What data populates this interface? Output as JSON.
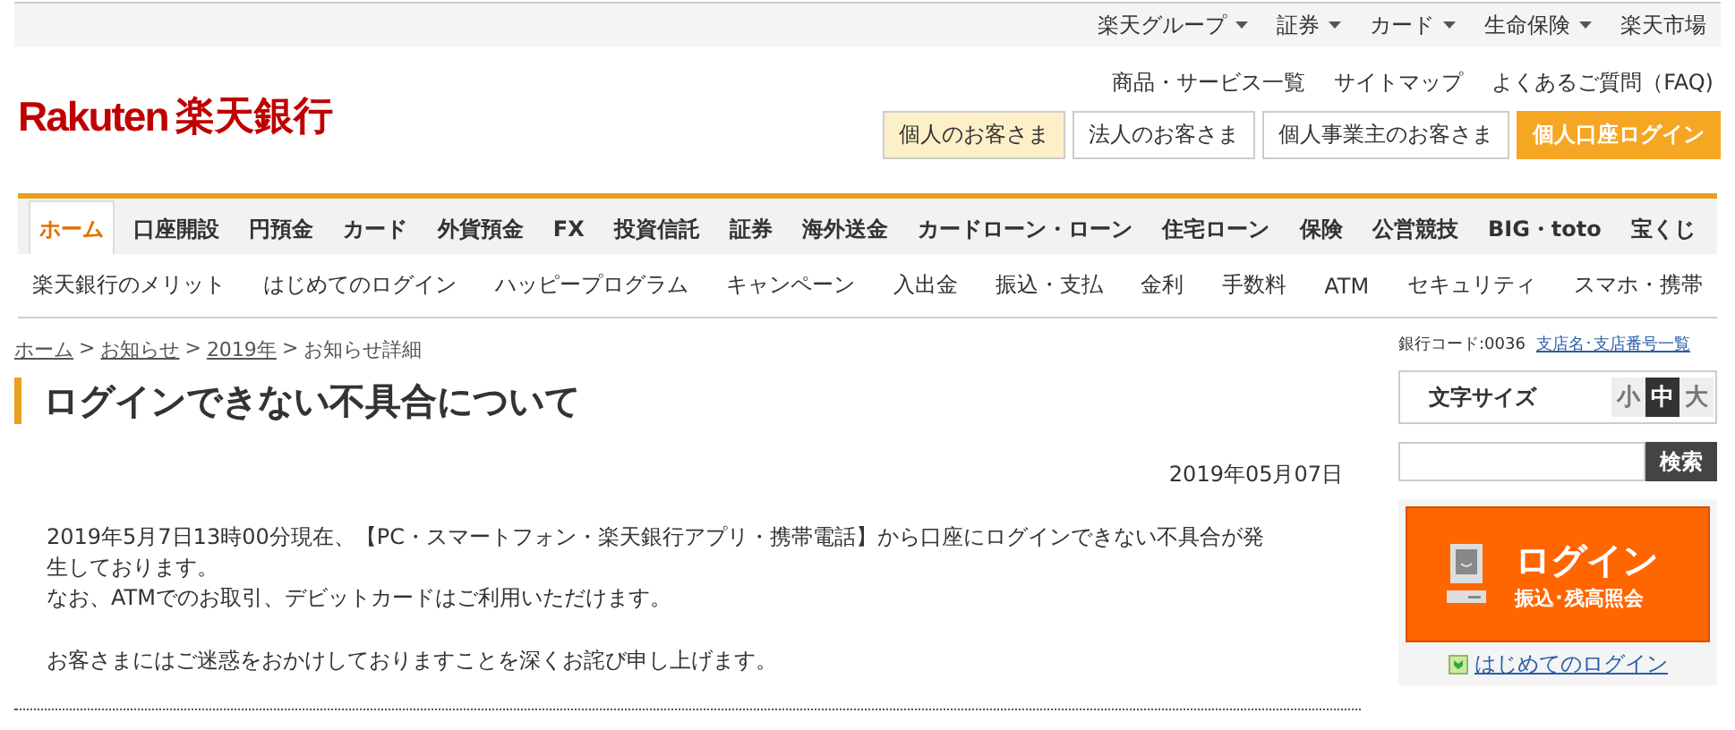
{
  "top_links": [
    {
      "label": "楽天グループ",
      "dropdown": true
    },
    {
      "label": "証券",
      "dropdown": true
    },
    {
      "label": "カード",
      "dropdown": true
    },
    {
      "label": "生命保険",
      "dropdown": true
    },
    {
      "label": "楽天市場",
      "dropdown": false
    }
  ],
  "logo": {
    "brand": "Rakuten",
    "name": "楽天銀行"
  },
  "utility_links": [
    "商品・サービス一覧",
    "サイトマップ",
    "よくあるご質問（FAQ)"
  ],
  "audience_buttons": [
    {
      "label": "個人のお客さま",
      "kind": "audience",
      "selected": true
    },
    {
      "label": "法人のお客さま",
      "kind": "audience",
      "selected": false
    },
    {
      "label": "個人事業主のお客さま",
      "kind": "audience",
      "selected": false
    },
    {
      "label": "個人口座ログイン",
      "kind": "primary"
    }
  ],
  "main_nav": [
    {
      "label": "ホーム",
      "selected": true
    },
    {
      "label": "口座開設",
      "selected": false
    },
    {
      "label": "円預金",
      "selected": false
    },
    {
      "label": "カード",
      "selected": false
    },
    {
      "label": "外貨預金",
      "selected": false
    },
    {
      "label": "FX",
      "selected": false
    },
    {
      "label": "投資信託",
      "selected": false
    },
    {
      "label": "証券",
      "selected": false
    },
    {
      "label": "海外送金",
      "selected": false
    },
    {
      "label": "カードローン・ローン",
      "selected": false
    },
    {
      "label": "住宅ローン",
      "selected": false
    },
    {
      "label": "保険",
      "selected": false
    },
    {
      "label": "公営競技",
      "selected": false
    },
    {
      "label": "BIG・toto",
      "selected": false
    },
    {
      "label": "宝くじ",
      "selected": false
    }
  ],
  "sub_nav": [
    "楽天銀行のメリット",
    "はじめてのログイン",
    "ハッピープログラム",
    "キャンペーン",
    "入出金",
    "振込・支払",
    "金利",
    "手数料",
    "ATM",
    "セキュリティ",
    "スマホ・携帯"
  ],
  "breadcrumb": [
    {
      "label": "ホーム",
      "link": true,
      "separator": ">"
    },
    {
      "label": "お知らせ",
      "link": true,
      "separator": ">"
    },
    {
      "label": "2019年",
      "link": true,
      "separator": ">"
    },
    {
      "label": "お知らせ詳細",
      "link": false
    }
  ],
  "heading": "ログインできない不具合について",
  "date": "2019年05月07日",
  "paragraphs": [
    [
      "2019年5月7日13時00分現在、【PC・スマートフォン・楽天銀行アプリ・携帯電話】から口座にログインできない不具合が発生しております。",
      "なお、ATMでのお取引、デビットカードはご利用いただけます。"
    ],
    [
      "お客さまにはご迷惑をおかけしておりますことを深くお詫び申し上げます。"
    ]
  ],
  "sidebar": {
    "bank_code": "銀行コード:0036",
    "branch_link": "支店名･支店番号一覧",
    "font_size": {
      "label": "文字サイズ",
      "options": [
        {
          "label": "小",
          "selected": false
        },
        {
          "label": "中",
          "selected": true
        },
        {
          "label": "大",
          "selected": false
        }
      ]
    },
    "search": {
      "button": "検索"
    },
    "login": {
      "title": "ログイン",
      "subtitle": "振込･残高照会"
    },
    "first_login": "はじめてのログイン"
  }
}
